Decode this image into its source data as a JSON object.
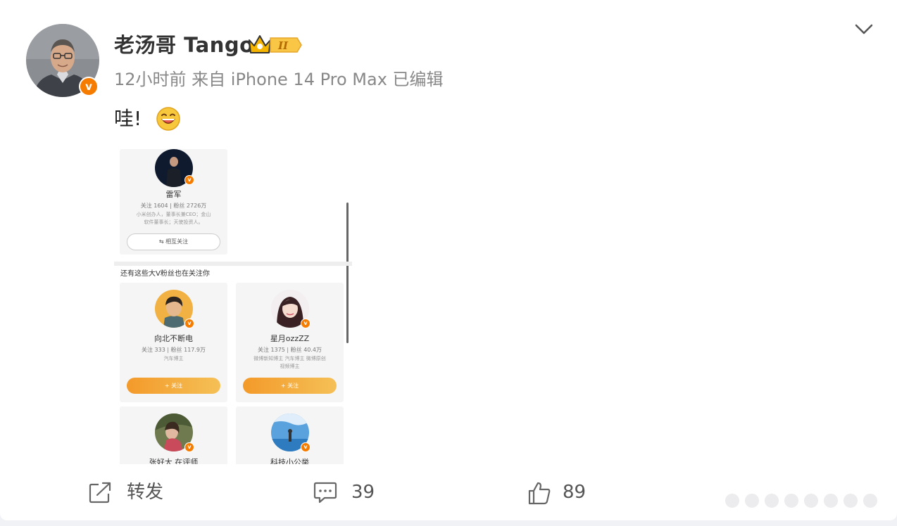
{
  "post": {
    "author": "老汤哥 Tango",
    "level_badge": "II",
    "meta": "12小时前  来自 iPhone 14 Pro Max 已编辑",
    "text": "哇!",
    "verified_mark": "v"
  },
  "embedded": {
    "top_user": {
      "name": "雷军",
      "stats": "关注 1604 | 粉丝 2726万",
      "desc_line1": "小米创办人，董事长兼CEO；金山",
      "desc_line2": "软件董事长；天使投资人。",
      "button": "⇆ 相互关注"
    },
    "section_title": "还有这些大V粉丝也在关注你",
    "users": [
      {
        "name": "向北不断电",
        "stats": "关注 333 | 粉丝 117.9万",
        "desc_line1": "汽车博主",
        "desc_line2": "",
        "button": "+ 关注"
      },
      {
        "name": "星月ozzZZ",
        "stats": "关注 1375 | 粉丝 40.4万",
        "desc_line1": "微博新知博主 汽车博主 微博原创",
        "desc_line2": "视频博主",
        "button": "+ 关注"
      },
      {
        "name": "张好大 在评师",
        "stats": "",
        "desc_line1": "",
        "desc_line2": "",
        "button": ""
      },
      {
        "name": "科技小公举",
        "stats": "",
        "desc_line1": "",
        "desc_line2": "",
        "button": ""
      }
    ]
  },
  "footer": {
    "repost_label": "转发",
    "comment_count": "39",
    "like_count": "89"
  },
  "icons": [
    "chevron-down-icon",
    "share-icon",
    "comment-icon",
    "like-icon",
    "crown-icon",
    "laughing-emoji"
  ],
  "colors": {
    "accent": "#f57c00",
    "follow_button": "#f39a2a"
  }
}
